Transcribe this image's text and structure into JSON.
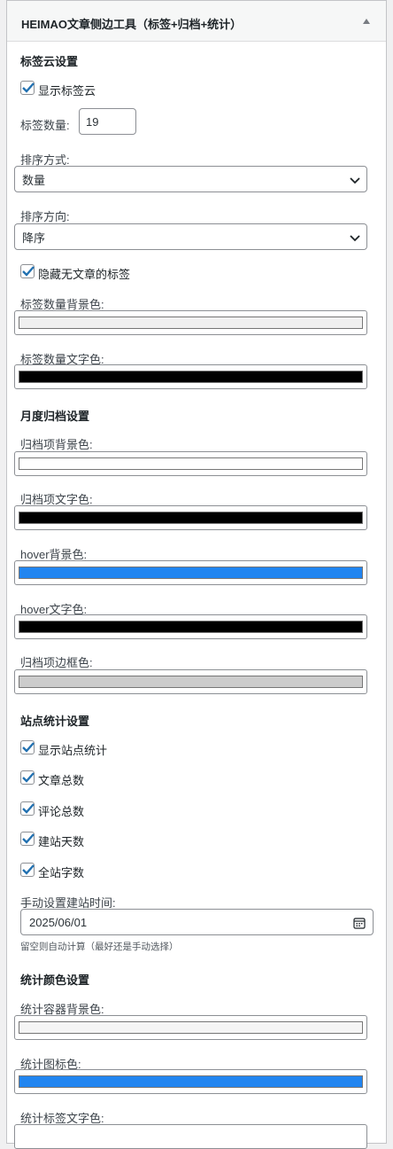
{
  "panel": {
    "title": "HEIMAO文章侧边工具（标签+归档+统计）"
  },
  "tag_cloud": {
    "section_title": "标签云设置",
    "show_tag_cloud": {
      "label": "显示标签云",
      "checked": true
    },
    "tag_count_label": "标签数量:",
    "tag_count_value": "19",
    "sort_by_label": "排序方式:",
    "sort_by_value": "数量",
    "sort_dir_label": "排序方向:",
    "sort_dir_value": "降序",
    "hide_empty": {
      "label": "隐藏无文章的标签",
      "checked": true
    },
    "count_bg_label": "标签数量背景色:",
    "count_bg_color": "#f0f0f0",
    "count_text_label": "标签数量文字色:",
    "count_text_color": "#000000"
  },
  "archive": {
    "section_title": "月度归档设置",
    "item_bg_label": "归档项背景色:",
    "item_bg_color": "#ffffff",
    "item_text_label": "归档项文字色:",
    "item_text_color": "#000000",
    "hover_bg_label": "hover背景色:",
    "hover_bg_color": "#2185f0",
    "hover_text_label": "hover文字色:",
    "hover_text_color": "#000000",
    "item_border_label": "归档项边框色:",
    "item_border_color": "#cccccc"
  },
  "stats": {
    "section_title": "站点统计设置",
    "show_stats": {
      "label": "显示站点统计",
      "checked": true
    },
    "post_total": {
      "label": "文章总数",
      "checked": true
    },
    "comment_total": {
      "label": "评论总数",
      "checked": true
    },
    "site_days": {
      "label": "建站天数",
      "checked": true
    },
    "word_total": {
      "label": "全站字数",
      "checked": true
    },
    "start_date_label": "手动设置建站时间:",
    "start_date_value": "2025/06/01",
    "start_date_hint": "留空则自动计算（最好还是手动选择）"
  },
  "stats_colors": {
    "section_title": "统计颜色设置",
    "container_bg_label": "统计容器背景色:",
    "container_bg_color": "#f5f5f5",
    "icon_color_label": "统计图标色:",
    "icon_color": "#2185f0",
    "label_text_label": "统计标签文字色:"
  },
  "accent_color": "#2271b1"
}
